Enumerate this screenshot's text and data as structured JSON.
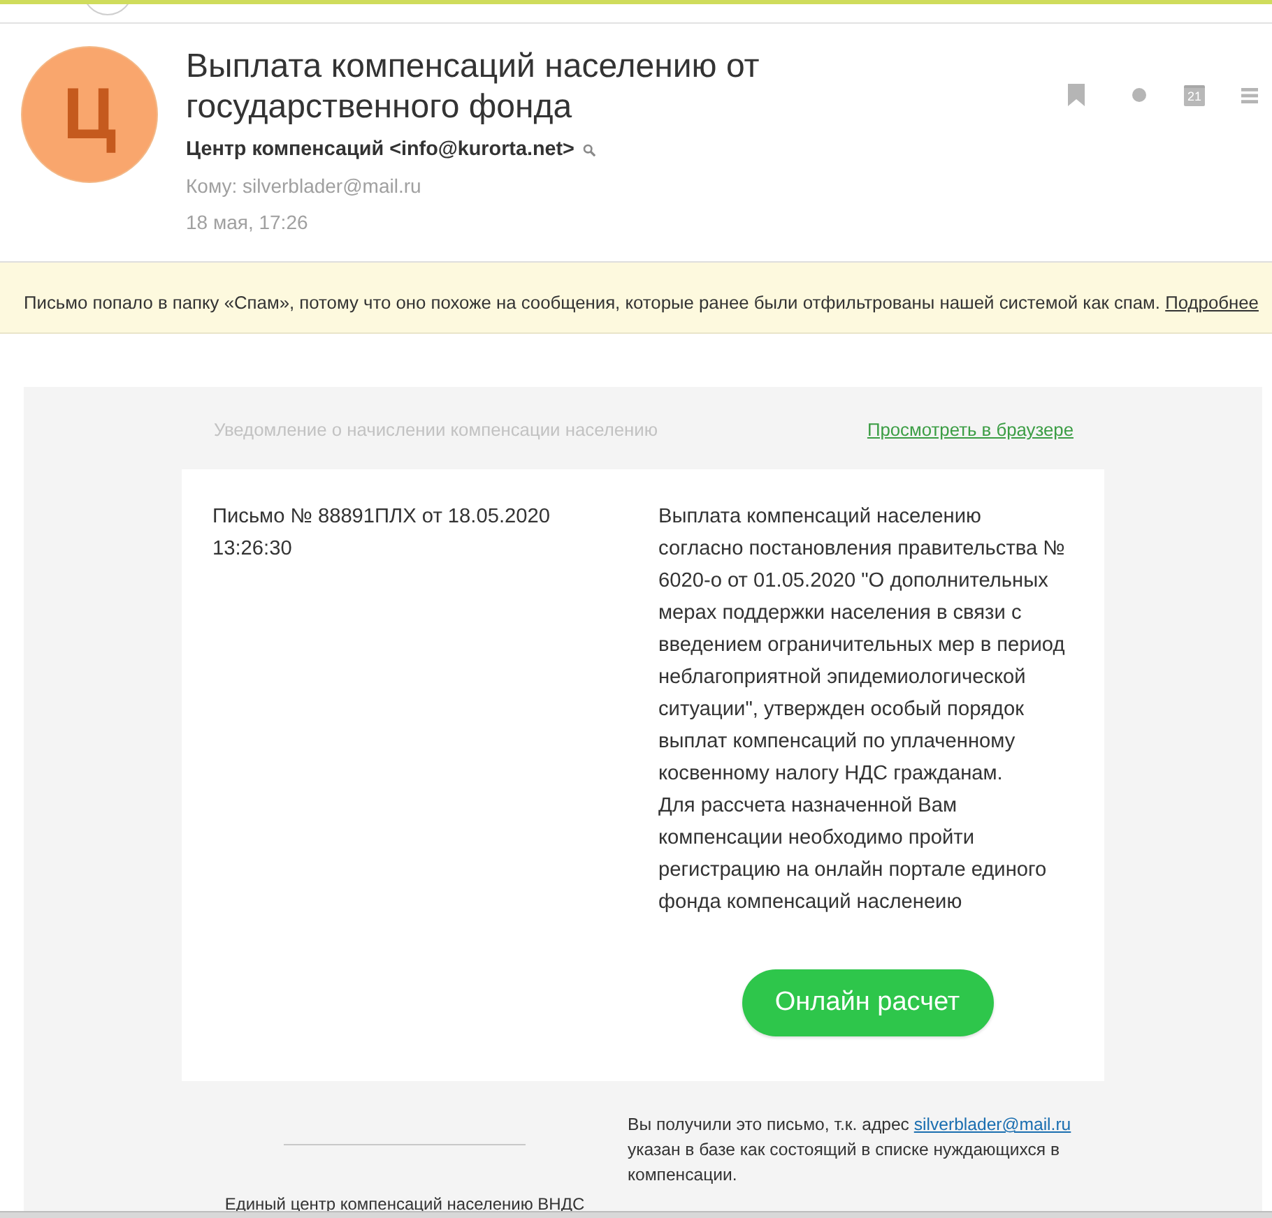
{
  "message": {
    "avatar_letter": "Ц",
    "subject": "Выплата компенсаций населению от государственного фонда",
    "sender": "Центр компенсаций <info@kurorta.net>",
    "recipient": "Кому: silverblader@mail.ru",
    "date": "18 мая, 17:26"
  },
  "toolbar": {
    "calendar_day": "21"
  },
  "spam_notice": {
    "text": "Письмо попало в папку «Спам», потому что оно похоже на сообщения, которые ранее были отфильтрованы нашей системой как спам.",
    "link": "Подробнее"
  },
  "email_body": {
    "preheader": "Уведомление о начислении компенсации населению",
    "browser_link": "Просмотреть в браузере",
    "letter_ref": "Письмо № 88891ПЛХ от 18.05.2020 13:26:30",
    "paragraphs": [
      "Выплата компенсаций населению согласно постановления правительства № 6020-о от 01.05.2020 \"О дополнительных мерах поддержки населения в связи с введением ограничительных мер в период неблагоприятной эпидемиологической ситуации\", утвержден особый порядок выплат компенсаций по уплаченному косвенному налогу НДС гражданам.",
      "Для рассчета назначенной Вам компенсации необходимо пройти регистрацию на онлайн портале единого фонда компенсаций насленеию"
    ],
    "button": "Онлайн расчет",
    "footer_org": "Единый центр компенсаций населению ВНДС",
    "footer_notice": {
      "before": "Вы получили это письмо, т.к. адрес",
      "link": "silverblader@mail.ru",
      "after": "указан в базе как состоящий в списке нуждающихся в компенсации."
    }
  }
}
